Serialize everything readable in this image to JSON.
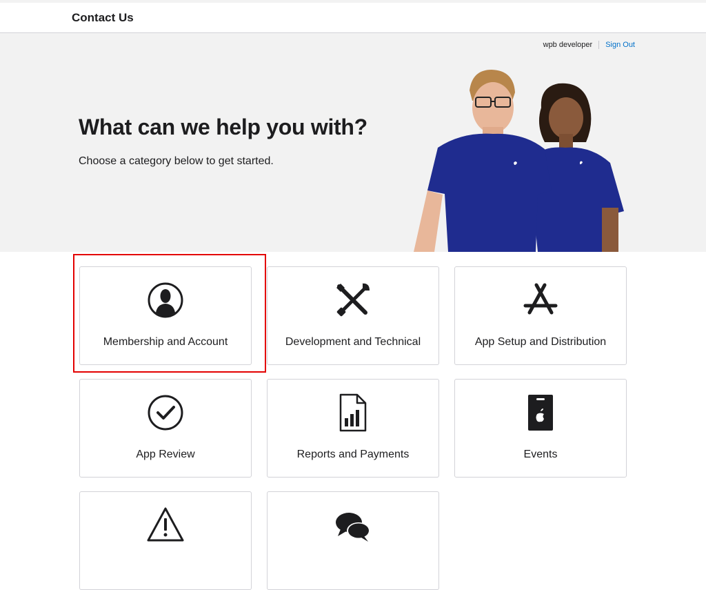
{
  "header": {
    "title": "Contact Us"
  },
  "account": {
    "user_name": "wpb developer",
    "sign_out_label": "Sign Out"
  },
  "hero": {
    "heading": "What can we help you with?",
    "subheading": "Choose a category below to get started."
  },
  "categories": [
    {
      "label": "Membership and Account",
      "icon": "person-icon"
    },
    {
      "label": "Development and Technical",
      "icon": "tools-icon"
    },
    {
      "label": "App Setup and Distribution",
      "icon": "app-store-icon"
    },
    {
      "label": "App Review",
      "icon": "checkmark-circle-icon"
    },
    {
      "label": "Reports and Payments",
      "icon": "report-document-icon"
    },
    {
      "label": "Events",
      "icon": "event-badge-icon"
    },
    {
      "label": "",
      "icon": "warning-icon"
    },
    {
      "label": "",
      "icon": "chat-bubbles-icon"
    }
  ],
  "colors": {
    "accent": "#0070c9",
    "hero_bg": "#f2f2f2",
    "shirt": "#1f2c8f",
    "highlight": "#e30000"
  }
}
